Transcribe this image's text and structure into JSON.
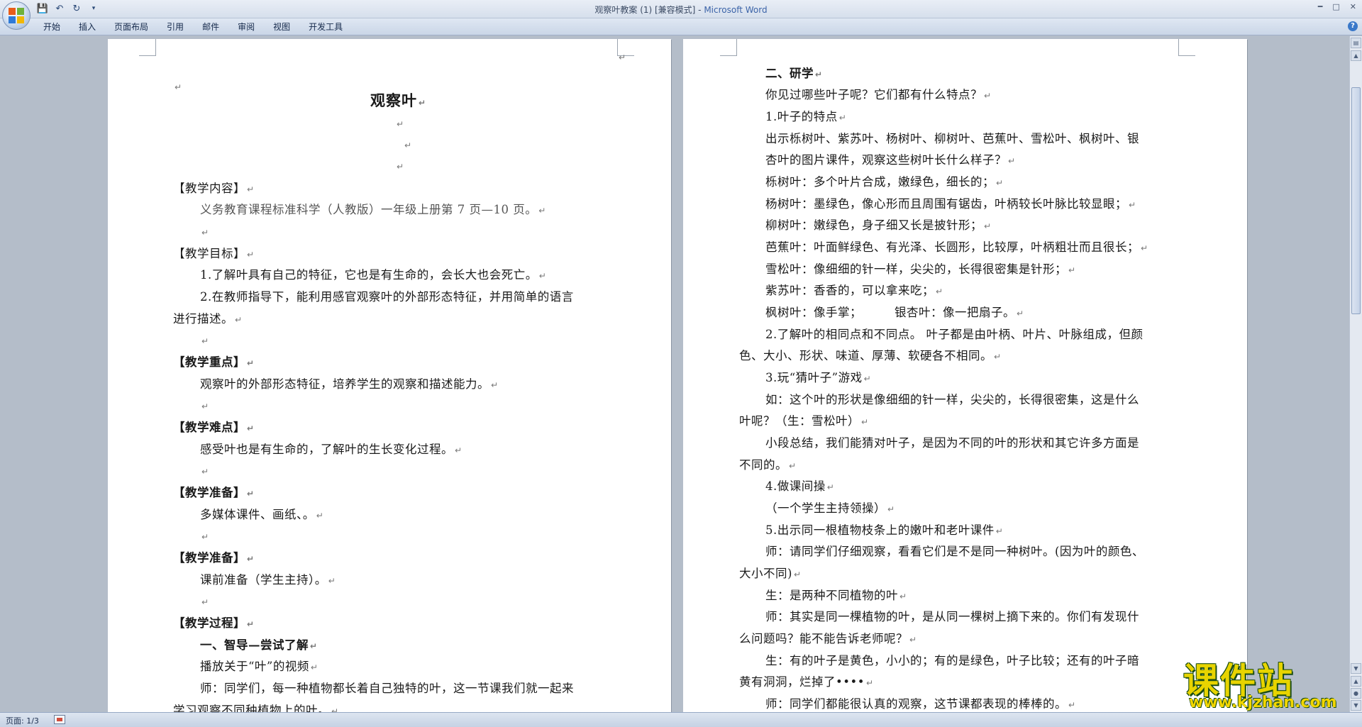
{
  "window": {
    "title": "观察叶教案 (1) [兼容模式] - ",
    "app_name": "Microsoft Word"
  },
  "quick_access": {
    "save_icon": "save-icon",
    "undo_icon": "undo-icon",
    "redo_icon": "redo-icon",
    "customize_icon": "dropdown-icon"
  },
  "ribbon": {
    "tabs": [
      "开始",
      "插入",
      "页面布局",
      "引用",
      "邮件",
      "审阅",
      "视图",
      "开发工具"
    ]
  },
  "colors": {
    "ribbon": "#d6dfec",
    "background": "#b4bdc9",
    "accent": "#3b63a8"
  },
  "left_page": {
    "title": "观察叶",
    "lines": [
      "【教学内容】",
      "义务教育课程标准科学（人教版）一年级上册第 7 页—10 页。",
      "【教学目标】",
      "1.了解叶具有自己的特征，它也是有生命的，会长大也会死亡。",
      "2.在教师指导下，能利用感官观察叶的外部形态特征，并用简单的语言",
      "进行描述。",
      "【教学重点】",
      "观察叶的外部形态特征，培养学生的观察和描述能力。",
      "【教学难点】",
      "感受叶也是有生命的，了解叶的生长变化过程。",
      "【教学准备】",
      "多媒体课件、画纸、。",
      "【教学准备】",
      "课前准备（学生主持）。",
      "【教学过程】",
      "一、智导—尝试了解",
      "播放关于“叶”的视频",
      "师：同学们，每一种植物都长着自己独特的叶，这一节课我们就一起来",
      "学习观察不同种植物上的叶。"
    ]
  },
  "right_page": {
    "lines": [
      "二、研学",
      "你见过哪些叶子呢？它们都有什么特点？",
      "1.叶子的特点",
      "出示栎树叶、紫苏叶、杨树叶、柳树叶、芭蕉叶、雪松叶、枫树叶、银",
      "杏叶的图片课件，观察这些树叶长什么样子？",
      "栎树叶：多个叶片合成，嫩绿色，细长的；",
      "杨树叶：墨绿色，像心形而且周围有锯齿，叶柄较长叶脉比较显眼；",
      "柳树叶：嫩绿色，身子细又长是披针形；",
      "芭蕉叶：叶面鲜绿色、有光泽、长圆形，比较厚，叶柄粗壮而且很长；",
      "雪松叶：像细细的针一样，尖尖的，长得很密集是针形；",
      "紫苏叶：香香的，可以拿来吃；",
      "枫树叶：像手掌；        银杏叶：像一把扇子。",
      "2.了解叶的相同点和不同点。 叶子都是由叶柄、叶片、叶脉组成，但颜",
      "色、大小、形状、味道、厚薄、软硬各不相同。",
      "3.玩“猜叶子”游戏",
      "如：这个叶的形状是像细细的针一样，尖尖的，长得很密集，这是什么",
      "叶呢？（生：雪松叶）",
      "小段总结，我们能猜对叶子，是因为不同的叶的形状和其它许多方面是",
      "不同的。",
      "4.做课间操",
      "（一个学生主持领操）",
      "5.出示同一根植物枝条上的嫩叶和老叶课件",
      "师：请同学们仔细观察，看看它们是不是同一种树叶。(因为叶的颜色、",
      "大小不同)",
      "生：是两种不同植物的叶",
      "师：其实是同一棵植物的叶，是从同一棵树上摘下来的。你们有发现什",
      "么问题吗？能不能告诉老师呢？",
      "生：有的叶子是黄色，小小的；有的是绿色，叶子比较；还有的叶子暗",
      "黄有洞洞，烂掉了••••",
      "师：同学们都能很认真的观察，这节课都表现的棒棒的。"
    ]
  },
  "status": {
    "page": "页面: 1/3"
  },
  "watermark": {
    "cn": "课件站",
    "url": "www.kjzhan.com"
  }
}
